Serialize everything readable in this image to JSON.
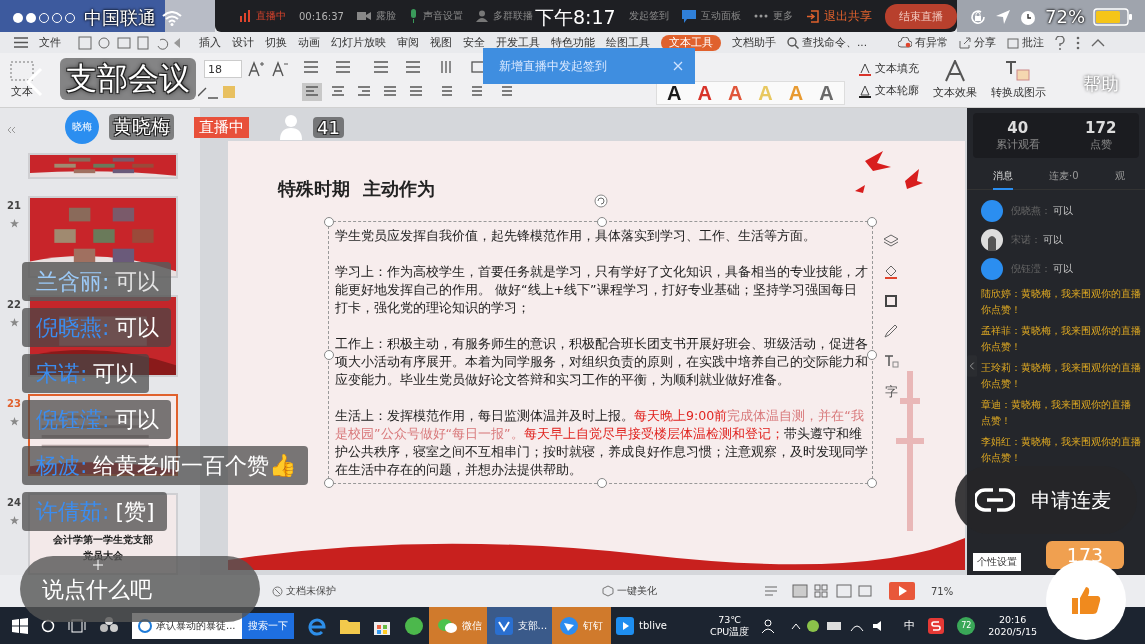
{
  "status_bar": {
    "carrier": "中国联通",
    "time": "下午8:17",
    "battery_text": "72%"
  },
  "live_header": {
    "title": "支部会议",
    "help": "帮助",
    "host": {
      "avatar": "晓梅",
      "name": "黄晓梅",
      "badge": "直播中",
      "viewers": "41"
    }
  },
  "share_toolbar": {
    "items": [
      {
        "kind": "live",
        "label": "直播中"
      },
      {
        "kind": "timer",
        "label": "00:16:37"
      },
      {
        "kind": "camera",
        "label": "露脸"
      },
      {
        "kind": "mic",
        "label": "声音设置"
      },
      {
        "kind": "person",
        "label": "多群联播"
      },
      {
        "kind": "gap",
        "label": "发起签到"
      },
      {
        "kind": "panel",
        "label": "互动面板"
      },
      {
        "kind": "more",
        "label": "更多"
      },
      {
        "kind": "exit",
        "label": "退出共享"
      },
      {
        "kind": "end",
        "label": "结束直播"
      }
    ]
  },
  "menu_bar": {
    "file": "文件",
    "tabs": [
      {
        "label": "插入",
        "selected": false
      },
      {
        "label": "设计",
        "selected": false
      },
      {
        "label": "切换",
        "selected": false
      },
      {
        "label": "动画",
        "selected": false
      },
      {
        "label": "幻灯片放映",
        "selected": false
      },
      {
        "label": "审阅",
        "selected": false
      },
      {
        "label": "视图",
        "selected": false
      },
      {
        "label": "安全",
        "selected": false
      },
      {
        "label": "开发工具",
        "selected": false
      },
      {
        "label": "特色功能",
        "selected": false
      },
      {
        "label": "绘图工具",
        "selected": false
      },
      {
        "label": "文本工具",
        "selected": true
      },
      {
        "label": "文档助手",
        "selected": false
      }
    ],
    "search": "查找命令、...",
    "sync": "有异常",
    "share": "分享",
    "comment": "批注"
  },
  "ribbon": {
    "textbox": "文本",
    "font_size": "18",
    "style_samples": [
      {
        "text": "A",
        "color": "#1a1a1a"
      },
      {
        "text": "A",
        "color": "#d8342a"
      },
      {
        "text": "A",
        "color": "#e0553a"
      },
      {
        "text": "A",
        "color": "#e8c860"
      },
      {
        "text": "A",
        "color": "#e89a30"
      },
      {
        "text": "A",
        "color": "#6a6a6a"
      }
    ],
    "fill": "文本填充",
    "outline": "文本轮廓",
    "effect": "文本效果",
    "convert": "转换成图示"
  },
  "notice_popup": {
    "text": "新增直播中发起签到"
  },
  "thumbnails": [
    {
      "kind": "photos",
      "selected": false
    },
    {
      "number": "21",
      "kind": "photos",
      "selected": false
    },
    {
      "number": "22",
      "kind": "red",
      "selected": false
    },
    {
      "number": "23",
      "kind": "text",
      "selected": true
    },
    {
      "number": "24",
      "kind": "cover",
      "selected": false,
      "caption": [
        "会计学第一学生党支部",
        "党员大会"
      ]
    }
  ],
  "slide": {
    "title": "特殊时期  主动作为",
    "paragraphs": [
      [
        {
          "text": "学生党员应发挥自我价值，起先锋模范作用，具体落实到学习、工作、生活等方面。",
          "color": "#222222"
        }
      ],
      [
        {
          "text": "学习上：作为高校学生，首要任务就是学习，只有学好了文化知识，具备相当的专业技能，才能更好地发挥自己的作用。 做好“线上+线下”课程学习，打好专业基础；坚持学习强国每日打卡，强化党的理论知识的学习；",
          "color": "#222222"
        }
      ],
      [
        {
          "text": "工作上：积极主动，有服务师生的意识，积极配合班长团支书开展好班会、班级活动，促进各项大小活动有序展开。本着为同学服务，对组织负责的原则，在实践中培养自己的交际能力和应变能力。毕业生党员做好论文答辩和实习工作的平衡，为顺利就业做好准备。",
          "color": "#222222"
        }
      ],
      [
        {
          "text": "生活上：发挥模范作用，每日监测体温并及时上报。",
          "color": "#222222"
        },
        {
          "text": "每天晚上9:00前",
          "color": "#e0231f"
        },
        {
          "text": "完成体温自测，并在“我是校园”公众号做好“每日一报”。",
          "color": "#d8787a"
        },
        {
          "text": "每天早上自觉尽早接受楼层体温检测和登记；",
          "color": "#e0231f"
        },
        {
          "text": "带头遵守和维护公共秩序，寝室之间不互相串门；按时就寝，养成良好作息习惯；注意观察，及时发现同学在生活中存在的问题，并想办法提供帮助。",
          "color": "#222222"
        }
      ]
    ],
    "tool_text": "字"
  },
  "live_panel": {
    "stats": [
      {
        "value": "40",
        "label": "累计观看"
      },
      {
        "value": "172",
        "label": "点赞"
      }
    ],
    "tabs": [
      {
        "label": "消息",
        "selected": true
      },
      {
        "label": "连麦·0",
        "selected": false
      },
      {
        "label": "观",
        "selected": false
      }
    ],
    "messages": [
      {
        "kind": "user",
        "name": "倪晓燕：",
        "text": "可以"
      },
      {
        "kind": "photo",
        "name": "宋诺：",
        "text": "可以"
      },
      {
        "kind": "user",
        "name": "倪钰滢：",
        "text": "可以"
      },
      {
        "kind": "notice",
        "lines": [
          "陆欣婷：黄晓梅，我来围观你的直播",
          "你点赞！"
        ]
      },
      {
        "kind": "notice",
        "lines": [
          "孟祥菲：黄晓梅，我来围观你的直播",
          "你点赞！"
        ]
      },
      {
        "kind": "notice",
        "lines": [
          "王玲莉：黄晓梅，我来围观你的直播",
          "你点赞！"
        ]
      },
      {
        "kind": "notice",
        "lines": [
          "章迪：黄晓梅，我来围观你的直播",
          "点赞！"
        ]
      },
      {
        "kind": "notice",
        "lines": [
          "李娟红：黄晓梅，我来围观你的直播",
          "你点赞！"
        ]
      }
    ],
    "custom_hint": "个性设置"
  },
  "chat_overlay": [
    {
      "name": "兰含丽:",
      "text": "可以",
      "faded": true
    },
    {
      "name": "倪晓燕:",
      "text": "可以",
      "faded": false
    },
    {
      "name": "宋诺:",
      "text": "可以",
      "faded": false
    },
    {
      "name": "倪钰滢:",
      "text": "可以",
      "faded": false
    },
    {
      "name": "杨波:",
      "text": "给黄老师一百个赞👍",
      "faded": false
    },
    {
      "name": "许倩茹:",
      "text": "[赞]",
      "faded": false
    }
  ],
  "comment_box": {
    "placeholder": "说点什么吧"
  },
  "apply_button": "申请连麦",
  "like_count": "173",
  "wps_status": {
    "protect": "文档未保护",
    "beautify": "一键美化",
    "zoom": "71%"
  },
  "taskbar": {
    "search_text": "承认暴动的暴徒...",
    "search_button": "搜索一下",
    "apps": [
      {
        "label": "微信",
        "kind": "wechat",
        "selected": false,
        "flashing": true
      },
      {
        "label": "支部...",
        "kind": "live",
        "selected": true,
        "flashing": false
      },
      {
        "label": "钉钉",
        "kind": "ding",
        "selected": false,
        "flashing": true
      },
      {
        "label": "tblive",
        "kind": "tv",
        "selected": false,
        "flashing": false
      }
    ],
    "temp": "73℃",
    "temp_label": "CPU温度",
    "ime": "中",
    "badge": "72",
    "clock": "20:16",
    "date": "2020/5/15"
  }
}
